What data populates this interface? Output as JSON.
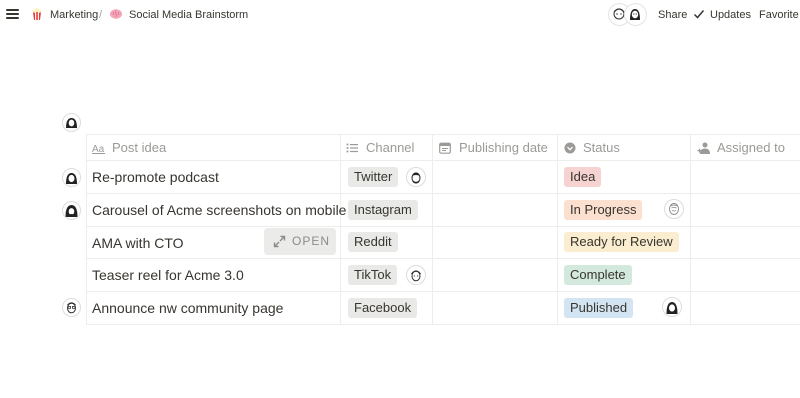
{
  "topbar": {
    "breadcrumbs": [
      {
        "icon": "popcorn-icon",
        "label": "Marketing"
      },
      {
        "icon": "brain-icon",
        "label": "Social Media Brainstorm"
      }
    ],
    "separator": "/",
    "share_label": "Share",
    "updates_label": "Updates",
    "favorite_label": "Favorite"
  },
  "table": {
    "columns": [
      {
        "icon": "text-aa-icon",
        "label": "Post idea"
      },
      {
        "icon": "list-icon",
        "label": "Channel"
      },
      {
        "icon": "calendar-icon",
        "label": "Publishing date"
      },
      {
        "icon": "status-circle-icon",
        "label": "Status"
      },
      {
        "icon": "person-icon",
        "label": "Assigned to"
      }
    ],
    "open_button_label": "OPEN",
    "rows": [
      {
        "post": "Re-promote podcast",
        "channel": "Twitter",
        "status": "Idea",
        "status_bg": "#f6d2d0",
        "date": "",
        "assigned": ""
      },
      {
        "post": "Carousel of Acme screenshots on mobile",
        "channel": "Instagram",
        "status": "In Progress",
        "status_bg": "#fbdfcf",
        "date": "",
        "assigned": ""
      },
      {
        "post": "AMA with CTO",
        "channel": "Reddit",
        "status": "Ready for Review",
        "status_bg": "#fbedcf",
        "date": "",
        "assigned": ""
      },
      {
        "post": "Teaser reel for Acme 3.0",
        "channel": "TikTok",
        "status": "Complete",
        "status_bg": "#d4e9dd",
        "date": "",
        "assigned": ""
      },
      {
        "post": "Announce nw community page",
        "channel": "Facebook",
        "status": "Published",
        "status_bg": "#d3e5f3",
        "date": "",
        "assigned": ""
      }
    ]
  },
  "colors": {
    "text": "#37352f",
    "muted": "#9b9a97",
    "tag_gray": "#e9e9e7",
    "border": "#ededec"
  }
}
